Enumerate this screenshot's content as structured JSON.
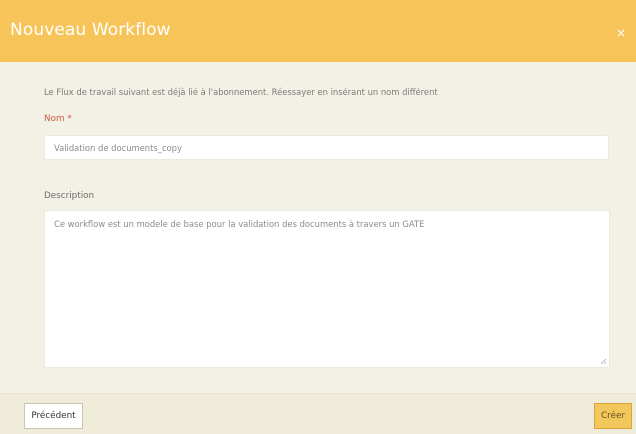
{
  "colors": {
    "header_bg": "#f7c459",
    "modal_bg": "#f3f1e6",
    "required_label": "#c65e3d",
    "primary_button": "#f2c75c"
  },
  "header": {
    "title": "Nouveau Workflow",
    "close_icon": "close-icon",
    "close_glyph": "×"
  },
  "form": {
    "notice": "Le Flux de travail suivant est déjà lié à l'abonnement. Réessayer en insérant un nom différent",
    "name_label": "Nom *",
    "name_value": "Validation de documents_copy",
    "description_label": "Description",
    "description_value": "Ce workflow est un modele de base pour la validation des documents à travers un GATE"
  },
  "footer": {
    "previous_label": "Précédent",
    "create_label": "Créer"
  }
}
